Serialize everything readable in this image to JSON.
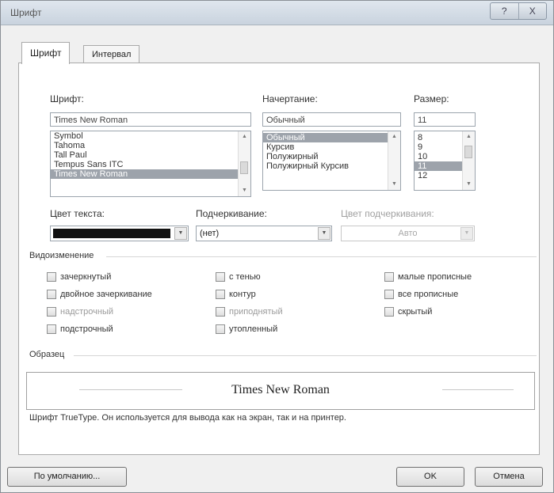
{
  "window": {
    "title": "Шрифт",
    "controls": [
      "?",
      "X"
    ]
  },
  "tabs": [
    {
      "label": "Шрифт"
    },
    {
      "label": "Интервал"
    }
  ],
  "font": {
    "label": "Шрифт:",
    "value": "Times New Roman",
    "options": [
      "Symbol",
      "Tahoma",
      "Tall Paul",
      "Tempus Sans ITC",
      "Times New Roman"
    ]
  },
  "style": {
    "label": "Начертание:",
    "value": "Обычный",
    "options": [
      "Обычный",
      "Курсив",
      "Полужирный",
      "Полужирный Курсив"
    ]
  },
  "size": {
    "label": "Размер:",
    "value": "11",
    "options": [
      "8",
      "9",
      "10",
      "11",
      "12"
    ]
  },
  "text_color": {
    "label": "Цвет текста:",
    "value": "#111111"
  },
  "underline": {
    "label": "Подчеркивание:",
    "value": "(нет)"
  },
  "underline_color": {
    "label": "Цвет подчеркивания:",
    "value": "Авто"
  },
  "effects": {
    "title": "Видоизменение",
    "col1": [
      "зачеркнутый",
      "двойное зачеркивание",
      "надстрочный",
      "подстрочный"
    ],
    "col2": [
      "с тенью",
      "контур",
      "приподнятый",
      "утопленный"
    ],
    "col3": [
      "малые прописные",
      "все прописные",
      "скрытый"
    ]
  },
  "preview": {
    "title": "Образец",
    "text": "Times New Roman"
  },
  "note": "Шрифт TrueType. Он используется для вывода как на экран, так и на принтер.",
  "buttons": {
    "default": "По умолчанию...",
    "ok": "OK",
    "cancel": "Отмена"
  }
}
